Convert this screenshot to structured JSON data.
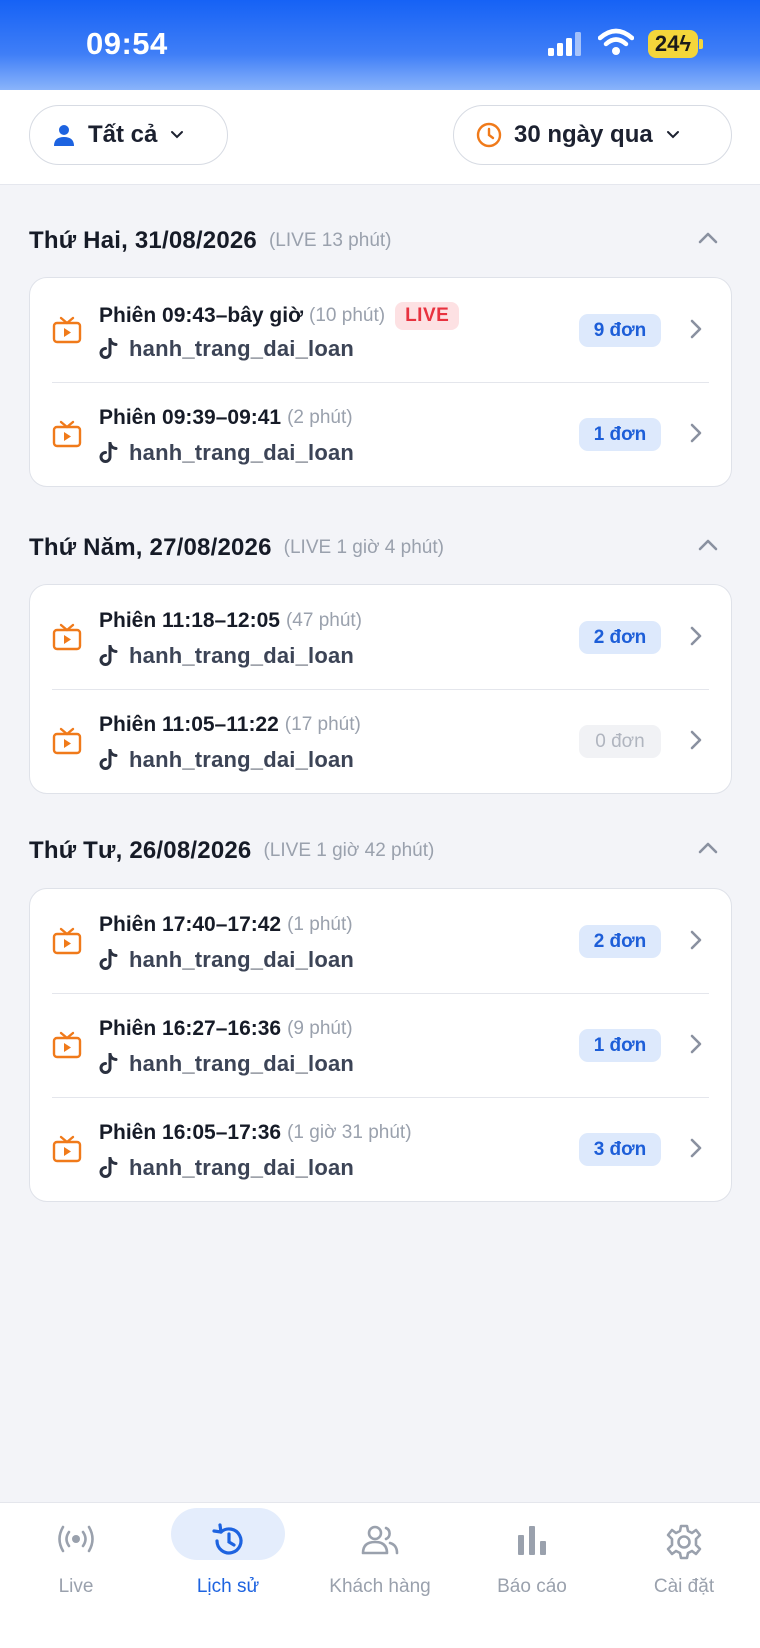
{
  "status": {
    "time": "09:54",
    "battery": "24"
  },
  "filters": {
    "user_label": "Tất cả",
    "range_label": "30 ngày qua"
  },
  "days": [
    {
      "title": "Thứ Hai, 31/08/2026",
      "duration": "(LIVE 13 phút)",
      "sessions": [
        {
          "label": "Phiên 09:43–bây giờ",
          "minutes": "(10 phút)",
          "live": "LIVE",
          "user": "hanh_trang_dai_loan",
          "orders": "9 đơn"
        },
        {
          "label": "Phiên 09:39–09:41",
          "minutes": "(2 phút)",
          "user": "hanh_trang_dai_loan",
          "orders": "1 đơn"
        }
      ]
    },
    {
      "title": "Thứ Năm, 27/08/2026",
      "duration": "(LIVE 1 giờ 4 phút)",
      "sessions": [
        {
          "label": "Phiên 11:18–12:05",
          "minutes": "(47 phút)",
          "user": "hanh_trang_dai_loan",
          "orders": "2 đơn"
        },
        {
          "label": "Phiên 11:05–11:22",
          "minutes": "(17 phút)",
          "user": "hanh_trang_dai_loan",
          "orders": "0 đơn"
        }
      ]
    },
    {
      "title": "Thứ Tư, 26/08/2026",
      "duration": "(LIVE 1 giờ 42 phút)",
      "sessions": [
        {
          "label": "Phiên 17:40–17:42",
          "minutes": "(1 phút)",
          "user": "hanh_trang_dai_loan",
          "orders": "2 đơn"
        },
        {
          "label": "Phiên 16:27–16:36",
          "minutes": "(9 phút)",
          "user": "hanh_trang_dai_loan",
          "orders": "1 đơn"
        },
        {
          "label": "Phiên 16:05–17:36",
          "minutes": "(1 giờ 31 phút)",
          "user": "hanh_trang_dai_loan",
          "orders": "3 đơn"
        }
      ]
    }
  ],
  "tabs": [
    {
      "label": "Live",
      "icon": "live-broadcast-icon"
    },
    {
      "label": "Lịch sử",
      "icon": "history-icon",
      "active": true
    },
    {
      "label": "Khách hàng",
      "icon": "customers-icon"
    },
    {
      "label": "Báo cáo",
      "icon": "bar-chart-icon"
    },
    {
      "label": "Cài đặt",
      "icon": "gear-icon"
    }
  ],
  "colors": {
    "accent": "#1d63e0",
    "live_red": "#e8323f",
    "tv_orange": "#f07a1a",
    "order_badge_bg": "#dde9fc"
  }
}
